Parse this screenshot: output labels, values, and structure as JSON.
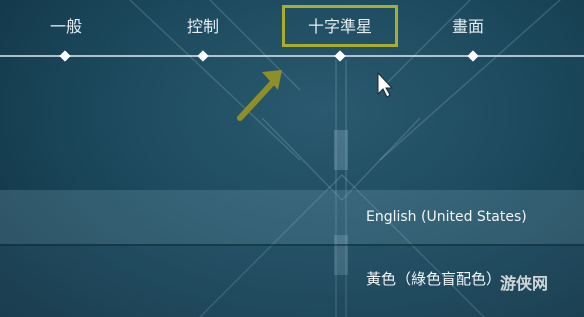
{
  "nav": {
    "tabs": [
      {
        "label": "一般",
        "active": false
      },
      {
        "label": "控制",
        "active": false
      },
      {
        "label": "十字準星",
        "active": true
      },
      {
        "label": "畫面",
        "active": false
      }
    ]
  },
  "settings": {
    "language_value": "English (United States)",
    "color_value": "黃色（綠色盲配色）"
  },
  "watermark": {
    "text": "游侠网"
  },
  "colors": {
    "highlight_box": "#a8ad2e",
    "arrow": "#8f8f2a",
    "background": "#1d4a5e"
  },
  "icons": {
    "annotation_arrow": "arrow-up-right-icon",
    "cursor": "mouse-pointer-icon",
    "tab_marker": "diamond-icon"
  }
}
